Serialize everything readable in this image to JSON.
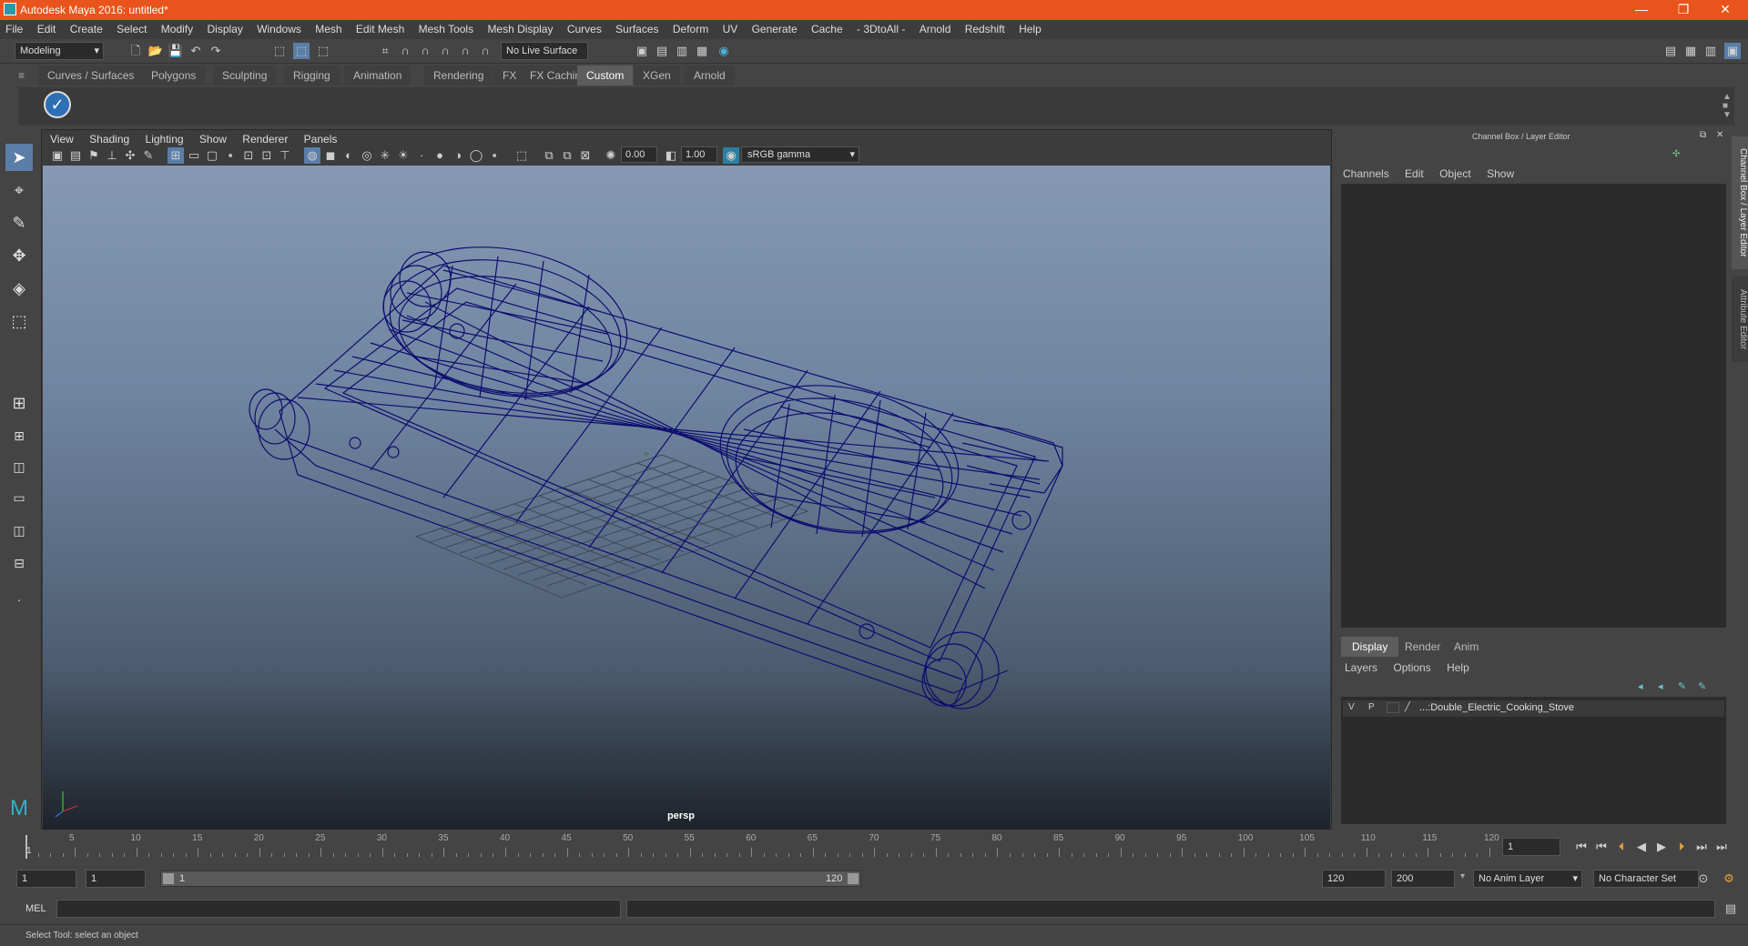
{
  "window": {
    "title": "Autodesk Maya 2016: untitled*",
    "minimize": "—",
    "restore": "❐",
    "close": "✕"
  },
  "menubar": [
    "File",
    "Edit",
    "Create",
    "Select",
    "Modify",
    "Display",
    "Windows",
    "Mesh",
    "Edit Mesh",
    "Mesh Tools",
    "Mesh Display",
    "Curves",
    "Surfaces",
    "Deform",
    "UV",
    "Generate",
    "Cache",
    "- 3DtoAll -",
    "Arnold",
    "Redshift",
    "Help"
  ],
  "statusline": {
    "mode": "Modeling",
    "live_surface": "No Live Surface"
  },
  "shelf": {
    "tabs": [
      "Curves / Surfaces",
      "Polygons",
      "Sculpting",
      "Rigging",
      "Animation",
      "Rendering",
      "FX",
      "FX Caching",
      "Custom",
      "XGen",
      "Arnold"
    ],
    "active": "Custom"
  },
  "viewport": {
    "menu": [
      "View",
      "Shading",
      "Lighting",
      "Show",
      "Renderer",
      "Panels"
    ],
    "exposure": "0.00",
    "gamma": "1.00",
    "colorspace": "sRGB gamma",
    "camera_label": "persp"
  },
  "channelbox": {
    "header": "Channel Box / Layer Editor",
    "menu": [
      "Channels",
      "Edit",
      "Object",
      "Show"
    ],
    "layer_tabs": [
      "Display",
      "Render",
      "Anim"
    ],
    "active_layer_tab": "Display",
    "layer_menu": [
      "Layers",
      "Options",
      "Help"
    ],
    "layers": [
      {
        "v": "V",
        "p": "P",
        "name": "...:Double_Electric_Cooking_Stove"
      }
    ]
  },
  "sidetabs": {
    "channel": "Channel Box / Layer Editor",
    "attribute": "Attribute Editor"
  },
  "timeline": {
    "ticks": [
      "5",
      "10",
      "15",
      "20",
      "25",
      "30",
      "35",
      "40",
      "45",
      "50",
      "55",
      "60",
      "65",
      "70",
      "75",
      "80",
      "85",
      "90",
      "95",
      "100",
      "105",
      "110",
      "115",
      "120"
    ],
    "start_marker": "1",
    "current_frame": "1"
  },
  "range": {
    "start": "1",
    "playback_start": "1",
    "slider_start": "1",
    "slider_end": "120",
    "playback_end": "120",
    "end": "200",
    "anim_layer": "No Anim Layer",
    "character_set": "No Character Set"
  },
  "cmdline": {
    "label": "MEL"
  },
  "helpline": {
    "text": "Select Tool: select an object"
  },
  "colors": {
    "titlebar": "#e8541b",
    "wireframe": "#0d0d6e",
    "viewport_top": "#8599b3",
    "viewport_bottom": "#1e232a"
  }
}
